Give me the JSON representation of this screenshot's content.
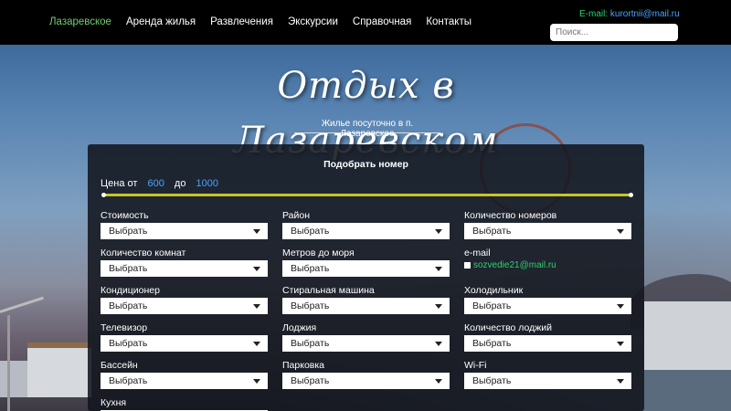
{
  "nav": {
    "items": [
      "Лазаревское",
      "Аренда жилья",
      "Развлечения",
      "Экскурсии",
      "Справочная",
      "Контакты"
    ],
    "active_index": 0
  },
  "contact": {
    "email_label": "E-mail:",
    "email": "kurortnii@mail.ru"
  },
  "search": {
    "placeholder": "Поиск..."
  },
  "hero": {
    "logo_text": "Отдых в Лазаревском",
    "subtitle": "Жилье посуточно в п. Лазаревское"
  },
  "filter": {
    "title": "Подобрать номер",
    "price_label": "Цена от",
    "price_from": "600",
    "price_to_label": "до",
    "price_to": "1000",
    "columns": [
      [
        {
          "label": "Стоимость",
          "value": "Выбрать"
        },
        {
          "label": "Количество комнат",
          "value": "Выбрать"
        },
        {
          "label": "Кондиционер",
          "value": "Выбрать"
        },
        {
          "label": "Телевизор",
          "value": "Выбрать"
        },
        {
          "label": "Бассейн",
          "value": "Выбрать"
        },
        {
          "label": "Кухня",
          "value": ""
        }
      ],
      [
        {
          "label": "Район",
          "value": "Выбрать"
        },
        {
          "label": "Метров до моря",
          "value": "Выбрать"
        },
        {
          "label": "Стиральная машина",
          "value": "Выбрать"
        },
        {
          "label": "Лоджия",
          "value": "Выбрать"
        },
        {
          "label": "Парковка",
          "value": "Выбрать"
        }
      ],
      [
        {
          "label": "Количество номеров",
          "value": "Выбрать"
        },
        {
          "label": "e-mail",
          "email": "sozvedie21@mail.ru"
        },
        {
          "label": "Холодильник",
          "value": "Выбрать"
        },
        {
          "label": "Количество лоджий",
          "value": "Выбрать"
        },
        {
          "label": "Wi-Fi",
          "value": "Выбрать"
        }
      ]
    ]
  },
  "colors": {
    "accent_green": "#6fcf6f",
    "link_blue": "#4aa3ff",
    "slider_yellow": "#c9c428"
  }
}
